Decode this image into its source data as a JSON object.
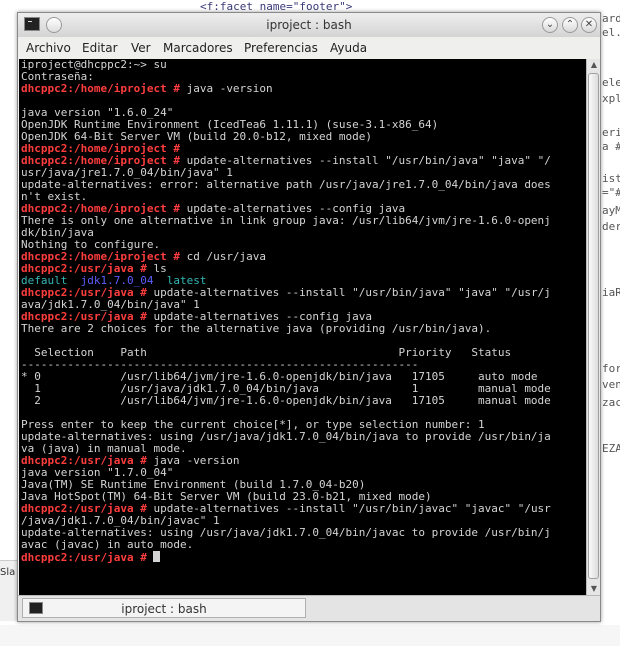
{
  "background": {
    "top_code": "<f:facet name=\"footer\">"
  },
  "window": {
    "title": "iproject : bash"
  },
  "menubar": {
    "items": [
      "Archivo",
      "Editar",
      "Ver",
      "Marcadores",
      "Preferencias",
      "Ayuda"
    ]
  },
  "terminal": {
    "lines": [
      [
        {
          "t": "iproject@dhcppc2:~> su"
        }
      ],
      [
        {
          "t": "Contraseña:"
        }
      ],
      [
        {
          "t": "dhcppc2:/home/iproject # ",
          "c": "prompt"
        },
        {
          "t": "java -version"
        }
      ],
      [
        {
          "t": ""
        }
      ],
      [
        {
          "t": "java version \"1.6.0_24\""
        }
      ],
      [
        {
          "t": "OpenJDK Runtime Environment (IcedTea6 1.11.1) (suse-3.1-x86_64)"
        }
      ],
      [
        {
          "t": "OpenJDK 64-Bit Server VM (build 20.0-b12, mixed mode)"
        }
      ],
      [
        {
          "t": "dhcppc2:/home/iproject # ",
          "c": "prompt"
        }
      ],
      [
        {
          "t": "dhcppc2:/home/iproject # ",
          "c": "prompt"
        },
        {
          "t": "update-alternatives --install \"/usr/bin/java\" \"java\" \"/"
        }
      ],
      [
        {
          "t": "usr/java/jre1.7.0_04/bin/java\" 1"
        }
      ],
      [
        {
          "t": "update-alternatives: error: alternative path /usr/java/jre1.7.0_04/bin/java does"
        }
      ],
      [
        {
          "t": "n't exist."
        }
      ],
      [
        {
          "t": "dhcppc2:/home/iproject # ",
          "c": "prompt"
        },
        {
          "t": "update-alternatives --config java"
        }
      ],
      [
        {
          "t": "There is only one alternative in link group java: /usr/lib64/jvm/jre-1.6.0-openj"
        }
      ],
      [
        {
          "t": "dk/bin/java"
        }
      ],
      [
        {
          "t": "Nothing to configure."
        }
      ],
      [
        {
          "t": "dhcppc2:/home/iproject # ",
          "c": "prompt"
        },
        {
          "t": "cd /usr/java"
        }
      ],
      [
        {
          "t": "dhcppc2:/usr/java # ",
          "c": "prompt"
        },
        {
          "t": "ls"
        }
      ],
      [
        {
          "t": "default",
          "c": "cyan"
        },
        {
          "t": "  "
        },
        {
          "t": "jdk1.7.0_04",
          "c": "blue"
        },
        {
          "t": "  "
        },
        {
          "t": "latest",
          "c": "cyan"
        }
      ],
      [
        {
          "t": "dhcppc2:/usr/java # ",
          "c": "prompt"
        },
        {
          "t": "update-alternatives --install \"/usr/bin/java\" \"java\" \"/usr/j"
        }
      ],
      [
        {
          "t": "ava/jdk1.7.0_04/bin/java\" 1"
        }
      ],
      [
        {
          "t": "dhcppc2:/usr/java # ",
          "c": "prompt"
        },
        {
          "t": "update-alternatives --config java"
        }
      ],
      [
        {
          "t": "There are 2 choices for the alternative java (providing /usr/bin/java)."
        }
      ],
      [
        {
          "t": ""
        }
      ],
      [
        {
          "t": "  Selection    Path                                      Priority   Status"
        }
      ],
      [
        {
          "t": "------------------------------------------------------------"
        }
      ],
      [
        {
          "t": "* 0            /usr/lib64/jvm/jre-1.6.0-openjdk/bin/java   17105     auto mode"
        }
      ],
      [
        {
          "t": "  1            /usr/java/jdk1.7.0_04/bin/java              1         manual mode"
        }
      ],
      [
        {
          "t": "  2            /usr/lib64/jvm/jre-1.6.0-openjdk/bin/java   17105     manual mode"
        }
      ],
      [
        {
          "t": ""
        }
      ],
      [
        {
          "t": "Press enter to keep the current choice[*], or type selection number: 1"
        }
      ],
      [
        {
          "t": "update-alternatives: using /usr/java/jdk1.7.0_04/bin/java to provide /usr/bin/ja"
        }
      ],
      [
        {
          "t": "va (java) in manual mode."
        }
      ],
      [
        {
          "t": "dhcppc2:/usr/java # ",
          "c": "prompt"
        },
        {
          "t": "java -version"
        }
      ],
      [
        {
          "t": "java version \"1.7.0_04\""
        }
      ],
      [
        {
          "t": "Java(TM) SE Runtime Environment (build 1.7.0_04-b20)"
        }
      ],
      [
        {
          "t": "Java HotSpot(TM) 64-Bit Server VM (build 23.0-b21, mixed mode)"
        }
      ],
      [
        {
          "t": "dhcppc2:/usr/java # ",
          "c": "prompt"
        },
        {
          "t": "update-alternatives --install \"/usr/bin/javac\" \"javac\" \"/usr"
        }
      ],
      [
        {
          "t": "/java/jdk1.7.0_04/bin/javac\" 1"
        }
      ],
      [
        {
          "t": "update-alternatives: using /usr/java/jdk1.7.0_04/bin/javac to provide /usr/bin/j"
        }
      ],
      [
        {
          "t": "avac (javac) in auto mode."
        }
      ],
      [
        {
          "t": "dhcppc2:/usr/java # ",
          "c": "prompt"
        },
        {
          "t": "",
          "cursor": true
        }
      ]
    ],
    "colors": {
      "background": "#000000",
      "text": "#d4d4d4",
      "prompt": "#ff3d3d",
      "directory": "#5c5cff",
      "link": "#34b7b7"
    }
  },
  "tabs": [
    {
      "label": "iproject : bash",
      "icon": "terminal-icon"
    }
  ]
}
